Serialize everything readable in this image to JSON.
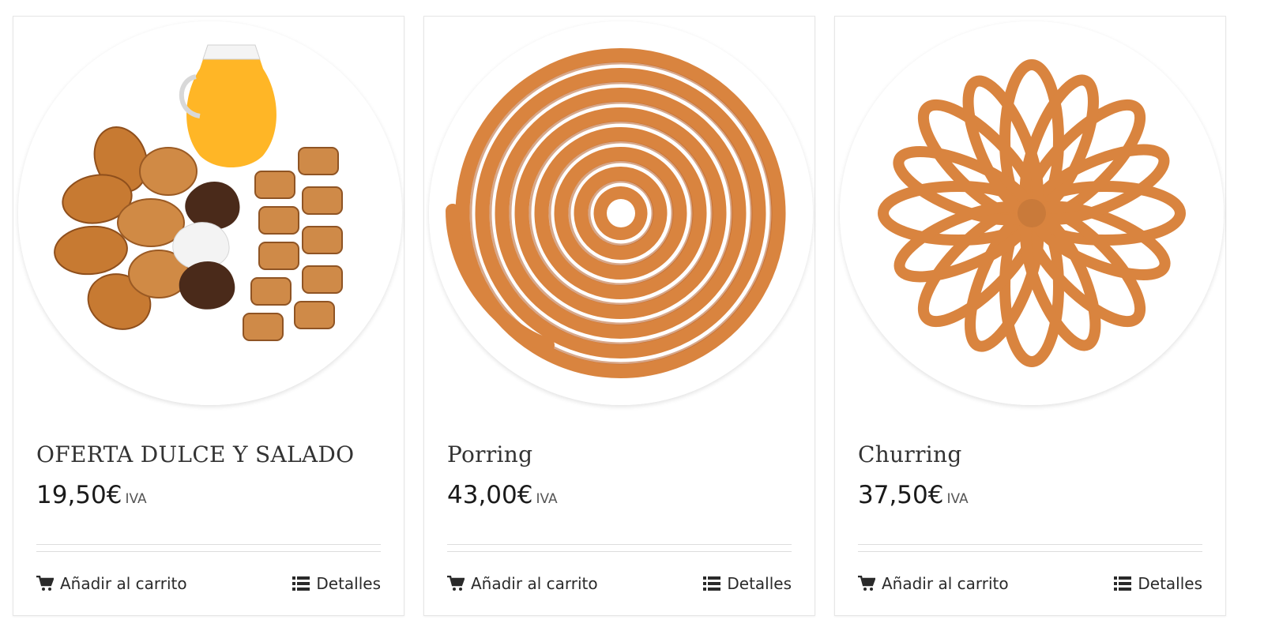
{
  "products": [
    {
      "title": "OFERTA DULCE Y SALADO",
      "price": "19,50€",
      "tax_label": "IVA",
      "add_to_cart_label": "Añadir al carrito",
      "details_label": "Detalles",
      "image": "assortment-pastries-juice"
    },
    {
      "title": "Porring",
      "price": "43,00€",
      "tax_label": "IVA",
      "add_to_cart_label": "Añadir al carrito",
      "details_label": "Detalles",
      "image": "spiral-churro"
    },
    {
      "title": "Churring",
      "price": "37,50€",
      "tax_label": "IVA",
      "add_to_cart_label": "Añadir al carrito",
      "details_label": "Detalles",
      "image": "looped-churros-flower"
    }
  ],
  "icons": {
    "cart": "cart-icon",
    "details": "list-icon"
  },
  "colors": {
    "churro": "#d9843f",
    "churro_dark": "#b8612a",
    "text": "#222222",
    "border": "#e6e6e6"
  }
}
